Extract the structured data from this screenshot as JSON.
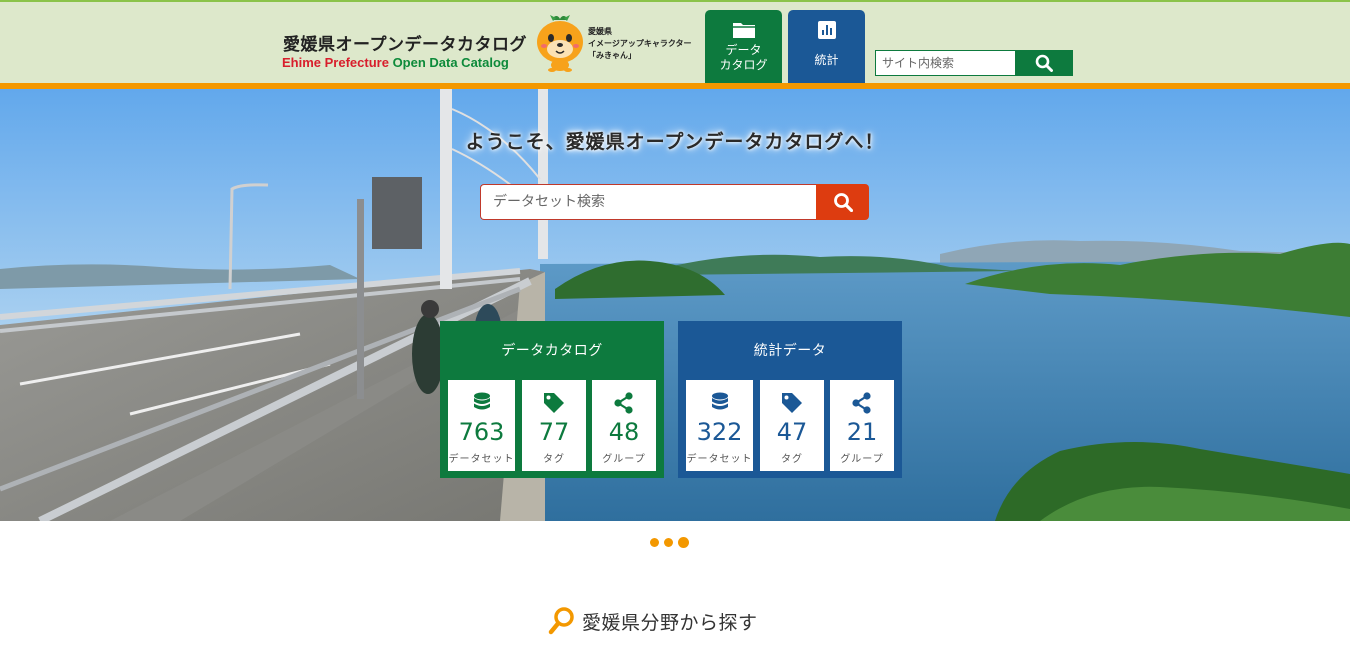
{
  "header": {
    "title_jp": "愛媛県オープンデータカタログ",
    "title_en_part1": "Ehime Prefecture",
    "title_en_part2": "Open Data Catalog",
    "mascot_caption": [
      "愛媛県",
      "イメージアップキャラクター",
      "「みきゃん」"
    ],
    "nav": [
      {
        "label": "データ\nカタログ",
        "icon": "folder-icon"
      },
      {
        "label": "統計",
        "icon": "bar-chart-icon"
      }
    ],
    "search": {
      "placeholder": "サイト内検索",
      "icon": "search-icon"
    }
  },
  "hero": {
    "welcome": "ようこそ、愛媛県オープンデータカタログへ！",
    "search": {
      "placeholder": "データセット検索",
      "icon": "search-icon"
    },
    "panels": [
      {
        "title": "データカタログ",
        "stats": [
          {
            "value": "763",
            "label": "データセット",
            "icon": "database-icon"
          },
          {
            "value": "77",
            "label": "タグ",
            "icon": "tag-icon"
          },
          {
            "value": "48",
            "label": "グループ",
            "icon": "share-icon"
          }
        ]
      },
      {
        "title": "統計データ",
        "stats": [
          {
            "value": "322",
            "label": "データセット",
            "icon": "database-icon"
          },
          {
            "value": "47",
            "label": "タグ",
            "icon": "tag-icon"
          },
          {
            "value": "21",
            "label": "グループ",
            "icon": "share-icon"
          }
        ]
      }
    ],
    "carousel": {
      "slides": 3,
      "active": 3
    }
  },
  "section": {
    "heading": "愛媛県分野から探す",
    "icon": "magnifier-icon"
  },
  "colors": {
    "green": "#0d7a3e",
    "blue": "#1b5896",
    "orange": "#f39800",
    "search_red": "#dd3c10",
    "header_bg": "#dde8cb"
  }
}
